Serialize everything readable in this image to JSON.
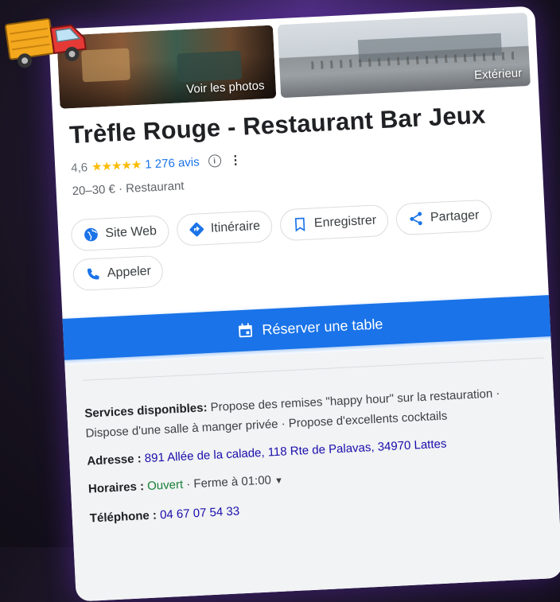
{
  "photos": {
    "primary_label": "Voir les photos",
    "secondary_label": "Extérieur"
  },
  "place": {
    "name": "Trèfle Rouge - Restaurant Bar Jeux",
    "rating": "4,6",
    "stars": "★★★★★",
    "reviews": "1 276 avis",
    "price_category": "20–30 € · Restaurant"
  },
  "actions": [
    {
      "label": "Site Web",
      "icon": "globe-icon"
    },
    {
      "label": "Itinéraire",
      "icon": "directions-icon"
    },
    {
      "label": "Enregistrer",
      "icon": "bookmark-icon"
    },
    {
      "label": "Partager",
      "icon": "share-icon"
    },
    {
      "label": "Appeler",
      "icon": "phone-icon"
    }
  ],
  "reserve": {
    "label": "Réserver une table",
    "icon": "calendar-icon"
  },
  "details": {
    "services_label": "Services disponibles:",
    "services_value": "Propose des remises \"happy hour\" sur la restauration · Dispose d'une salle à manger privée · Propose d'excellents cocktails",
    "address_label": "Adresse :",
    "address_value": "891 Allée de la calade, 118 Rte de Palavas, 34970 Lattes",
    "hours_label": "Horaires :",
    "hours_status": "Ouvert",
    "hours_close": "· Ferme à 01:00",
    "phone_label": "Téléphone :",
    "phone_value": "04 67 07 54 33"
  },
  "colors": {
    "accent": "#1a73e8",
    "stars": "#fbbc04",
    "open": "#188038",
    "link": "#1a0dab"
  }
}
